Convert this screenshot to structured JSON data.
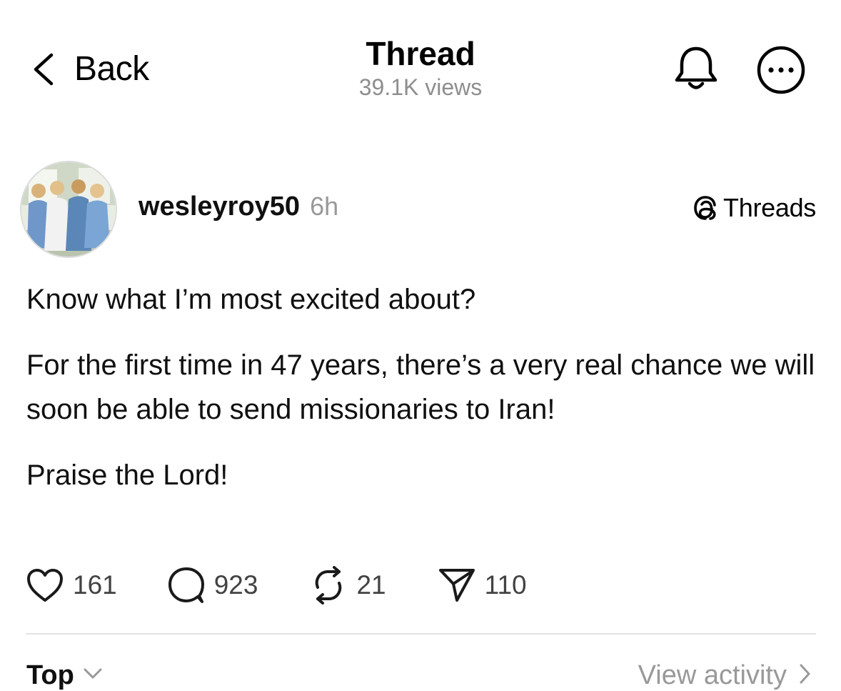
{
  "nav": {
    "back_label": "Back",
    "title": "Thread",
    "subtitle": "39.1K views",
    "icons": [
      "chevron-left-icon",
      "bell-icon",
      "more-options-icon"
    ]
  },
  "post": {
    "author": "wesleyroy50",
    "time": "6h",
    "badge_label": "Threads",
    "paragraphs": [
      "Know what I’m most excited about?",
      "For the first time in 47 years, there’s a very real chance we will soon be able to send missionaries to Iran!",
      "Praise the Lord!"
    ],
    "stats": {
      "likes": "161",
      "replies": "923",
      "reposts": "21",
      "shares": "110"
    }
  },
  "footer": {
    "sort_label": "Top",
    "activity_label": "View activity"
  },
  "colors": {
    "text": "#101010",
    "muted": "#999999",
    "divider": "#e4e4e4",
    "background": "#ffffff"
  }
}
